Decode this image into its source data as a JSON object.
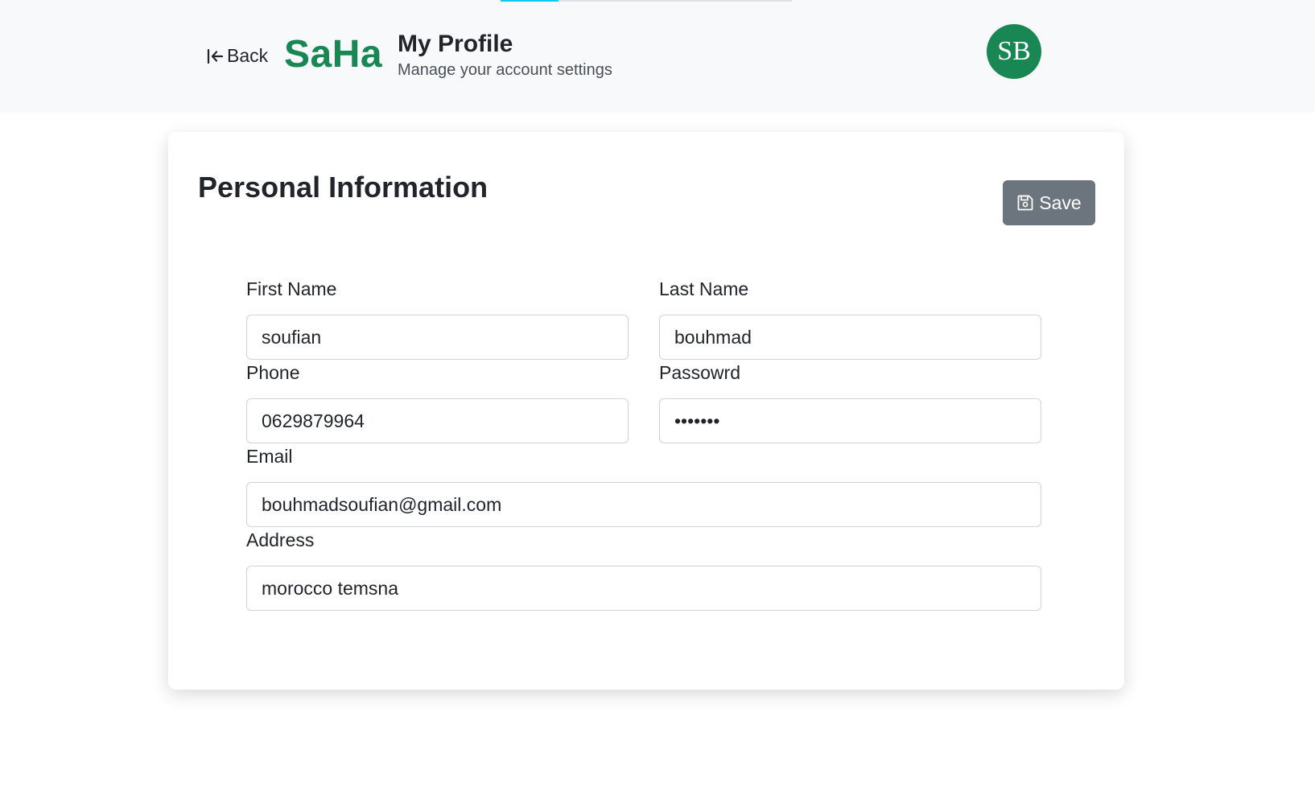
{
  "header": {
    "progress_fraction": 0.2,
    "back_label": "Back",
    "brand": "SaHa",
    "page_title": "My Profile",
    "page_subtitle": "Manage your account settings",
    "avatar_initials": "SB"
  },
  "card": {
    "title": "Personal Information",
    "save_label": "Save"
  },
  "form": {
    "first_name": {
      "label": "First Name",
      "value": "soufian"
    },
    "last_name": {
      "label": "Last Name",
      "value": "bouhmad"
    },
    "phone": {
      "label": "Phone",
      "value": "0629879964"
    },
    "password": {
      "label": "Passowrd",
      "value": "1234567"
    },
    "email": {
      "label": "Email",
      "value": "bouhmadsoufian@gmail.com"
    },
    "address": {
      "label": "Address",
      "value": "morocco temsna"
    }
  },
  "icons": {
    "back": "arrow-bar-left-icon",
    "save": "floppy-disk-icon"
  },
  "colors": {
    "brand": "#198754",
    "topbar_bg": "#f8f9fa",
    "save_button": "#6c757d",
    "progress": "#0dcaf0"
  }
}
